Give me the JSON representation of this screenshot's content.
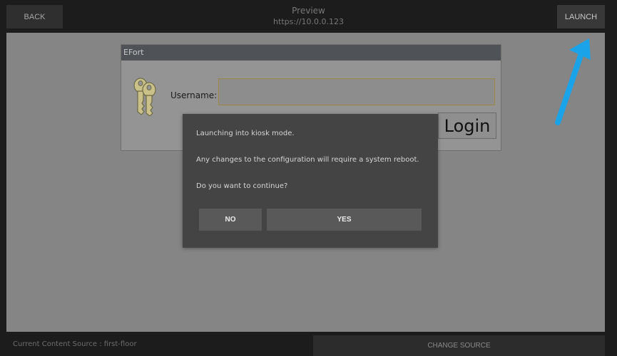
{
  "topbar": {
    "back_label": "BACK",
    "title": "Preview",
    "url": "https://10.0.0.123",
    "launch_label": "LAUNCH"
  },
  "login_page": {
    "window_title": "EFort",
    "username_label": "Username:",
    "username_value": "",
    "login_label": "Login",
    "icon": "keys-icon"
  },
  "dialog": {
    "line1": "Launching into kiosk mode.",
    "line2": "Any changes to the configuration will require a system reboot.",
    "line3": "Do you want to continue?",
    "no_label": "NO",
    "yes_label": "YES"
  },
  "annotation": {
    "icon": "arrow-icon",
    "color": "#1aa3e8"
  },
  "bottombar": {
    "source_label": "Current Content Source : first-floor",
    "change_source_label": "CHANGE SOURCE"
  }
}
